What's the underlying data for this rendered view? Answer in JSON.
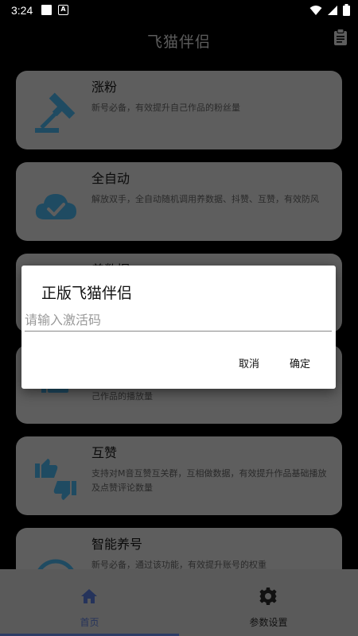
{
  "status": {
    "time": "3:24",
    "a_label": "A"
  },
  "appbar": {
    "title": "飞猫伴侣"
  },
  "cards": [
    {
      "title": "涨粉",
      "desc": "新号必备，有效提升自己作品的粉丝量",
      "icon": "gavel-icon"
    },
    {
      "title": "全自动",
      "desc": "解放双手，全自动随机调用养数据、抖赞、互赞，有效防风",
      "icon": "cloud-check-icon"
    },
    {
      "title": "养数据",
      "desc": "",
      "icon": "chart-icon"
    },
    {
      "title": "",
      "desc": "己作品的播放量",
      "icon": "thumb-icon"
    },
    {
      "title": "互赞",
      "desc": "支持对M音互赞互关群，互相做数据，有效提升作品基础播放及点赞评论数量",
      "icon": "thumbs-icon"
    },
    {
      "title": "智能养号",
      "desc": "新号必备，通过该功能，有效提升账号的权重",
      "icon": "copyright-icon"
    }
  ],
  "bottom_nav": {
    "home_label": "首页",
    "settings_label": "参数设置"
  },
  "dialog": {
    "title": "正版飞猫伴侣",
    "input_placeholder": "请输入激活码",
    "input_value": "",
    "cancel_label": "取消",
    "ok_label": "确定"
  },
  "colors": {
    "icon_blue": "#1f4b62",
    "card_bg": "#5e5e5e",
    "nav_active": "#25335b"
  }
}
